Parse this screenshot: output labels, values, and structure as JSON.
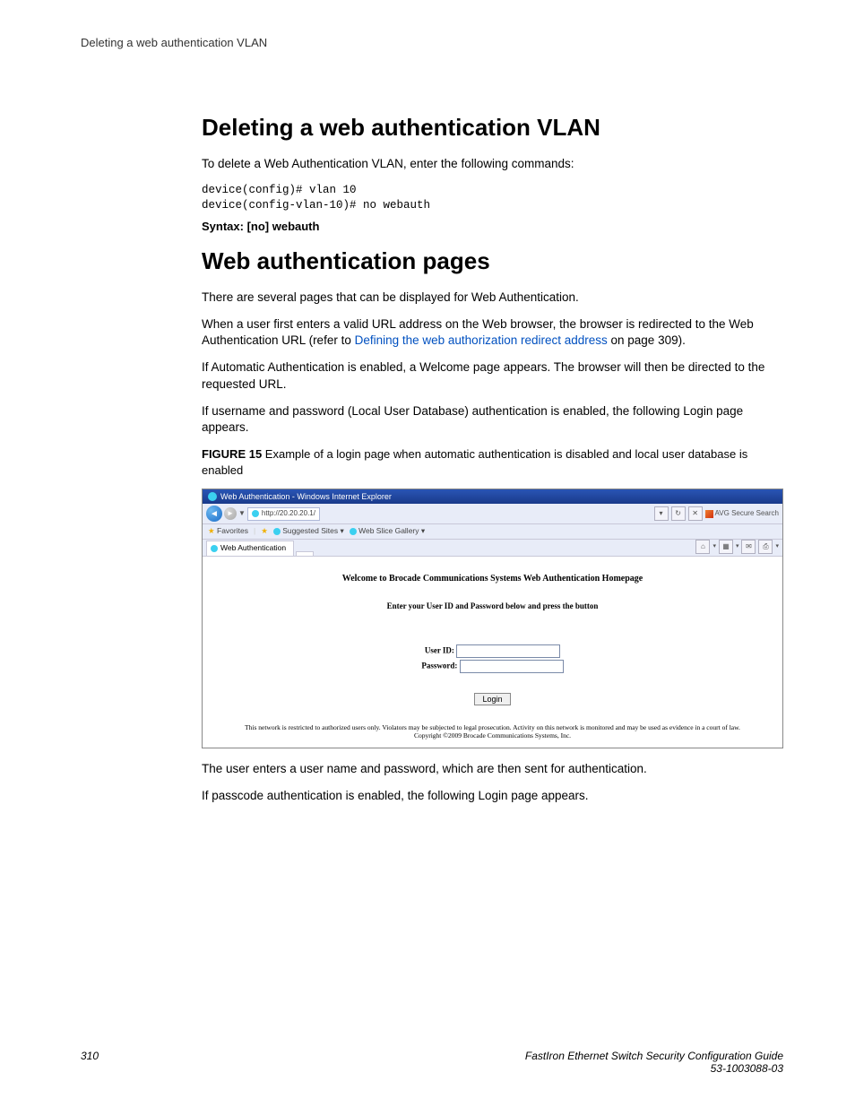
{
  "runningHeader": "Deleting a web authentication VLAN",
  "section1": {
    "title": "Deleting a web authentication VLAN",
    "intro": "To delete a Web Authentication VLAN, enter the following commands:",
    "code": "device(config)# vlan 10\ndevice(config-vlan-10)# no webauth",
    "syntax": "Syntax: [no] webauth"
  },
  "section2": {
    "title": "Web authentication pages",
    "p1": "There are several pages that can be displayed for Web Authentication.",
    "p2a": "When a user first enters a valid URL address on the Web browser, the browser is redirected to the Web Authentication URL (refer to ",
    "p2link": "Defining the web authorization redirect address",
    "p2b": " on page 309).",
    "p3": "If Automatic Authentication is enabled, a Welcome page appears. The browser will then be directed to the requested URL.",
    "p4": "If username and password (Local User Database) authentication is enabled, the following Login page appears.",
    "figCaptionLabel": "FIGURE 15",
    "figCaptionText": " Example of a login page when automatic authentication is disabled and local user database is enabled",
    "p5": "The user enters a user name and password, which are then sent for authentication.",
    "p6": "If passcode authentication is enabled, the following Login page appears."
  },
  "browser": {
    "windowTitle": "Web Authentication - Windows Internet Explorer",
    "url": "http://20.20.20.1/",
    "avg": "AVG Secure Search",
    "favorites": "Favorites",
    "suggested": "Suggested Sites",
    "gallery": "Web Slice Gallery",
    "tabTitle": "Web Authentication",
    "heading": "Welcome to Brocade Communications Systems Web Authentication Homepage",
    "sub": "Enter your User ID and Password below and press the button",
    "userLabel": "User ID:",
    "passLabel": "Password:",
    "loginBtn": "Login",
    "disclaimer1": "This network is restricted to authorized users only. Violators may be subjected to legal prosecution. Activity on this network is monitored and may be used as evidence in a court of law.",
    "disclaimer2": "Copyright ©2009 Brocade Communications Systems, Inc."
  },
  "footer": {
    "pageNum": "310",
    "bookTitle": "FastIron Ethernet Switch Security Configuration Guide",
    "docNum": "53-1003088-03"
  }
}
